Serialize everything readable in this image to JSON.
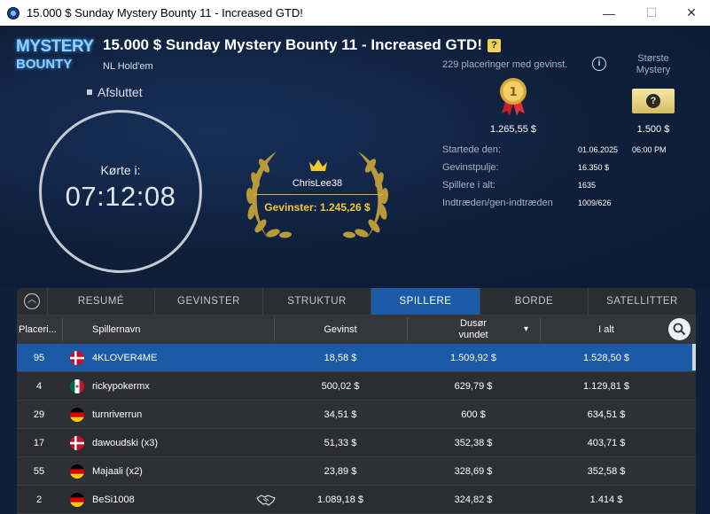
{
  "window": {
    "title": "15.000 $ Sunday Mystery Bounty 11 - Increased GTD!",
    "min_glyph": "—",
    "max_glyph": "☐",
    "close_glyph": "✕"
  },
  "logo": {
    "line1": "MYSTERY",
    "line2": "BOUNTY"
  },
  "tournament": {
    "title": "15.000 $ Sunday Mystery Bounty 11 - Increased GTD!",
    "help_glyph": "?",
    "game": "NL Hold'em",
    "status": "Afsluttet"
  },
  "timer": {
    "label": "Kørte i:",
    "value": "07:12:08"
  },
  "winner": {
    "name": "ChrisLee38",
    "prize": "Gevinster: 1.245,26 $"
  },
  "payouts": {
    "places_text": "229 placeringer med gevinst.",
    "info_glyph": "i",
    "first_prize": "1.265,55 $",
    "medal_number": "1",
    "biggest_label": "Største Mystery",
    "mystery_glyph": "?",
    "mystery_prize": "1.500 $"
  },
  "stats": [
    {
      "key": "Startede den:",
      "value": "01.06.2025",
      "value2": "06:00 PM"
    },
    {
      "key": "Gevinstpulje:",
      "value": "16.350 $",
      "value2": ""
    },
    {
      "key": "Spillere i alt:",
      "value": "1635",
      "value2": ""
    },
    {
      "key": "Indtræden/gen-indtræden",
      "value": "1009/626",
      "value2": ""
    }
  ],
  "tabs": {
    "collapse_glyph": "︿",
    "items": [
      "RESUMÉ",
      "GEVINSTER",
      "STRUKTUR",
      "SPILLERE",
      "BORDE",
      "SATELLITTER"
    ],
    "active": "SPILLERE"
  },
  "columns": {
    "place": "Placeri...",
    "name": "Spillernavn",
    "prize": "Gevinst",
    "bounty_line1": "Dusør",
    "bounty_line2": "vundet",
    "sort_glyph": "▾",
    "total": "I alt"
  },
  "players": [
    {
      "place": "95",
      "name": "4KLOVER4ME",
      "country": "dk",
      "prize": "18,58 $",
      "bounty": "1.509,92 $",
      "total": "1.528,50 $",
      "deal": false
    },
    {
      "place": "4",
      "name": "rickypokermx",
      "country": "mx",
      "prize": "500,02 $",
      "bounty": "629,79 $",
      "total": "1.129,81 $",
      "deal": false
    },
    {
      "place": "29",
      "name": "turnriverrun",
      "country": "de",
      "prize": "34,51 $",
      "bounty": "600 $",
      "total": "634,51 $",
      "deal": false
    },
    {
      "place": "17",
      "name": "dawoudski (x3)",
      "country": "dk",
      "prize": "51,33 $",
      "bounty": "352,38 $",
      "total": "403,71 $",
      "deal": false
    },
    {
      "place": "55",
      "name": "Majaali (x2)",
      "country": "de",
      "prize": "23,89 $",
      "bounty": "328,69 $",
      "total": "352,58 $",
      "deal": false
    },
    {
      "place": "2",
      "name": "BeSi1008",
      "country": "de",
      "prize": "1.089,18 $",
      "bounty": "324,82 $",
      "total": "1.414 $",
      "deal": true
    }
  ],
  "colors": {
    "accent_blue": "#1b5aa6",
    "gold": "#f3c93a",
    "background": "#0f1f3a"
  }
}
